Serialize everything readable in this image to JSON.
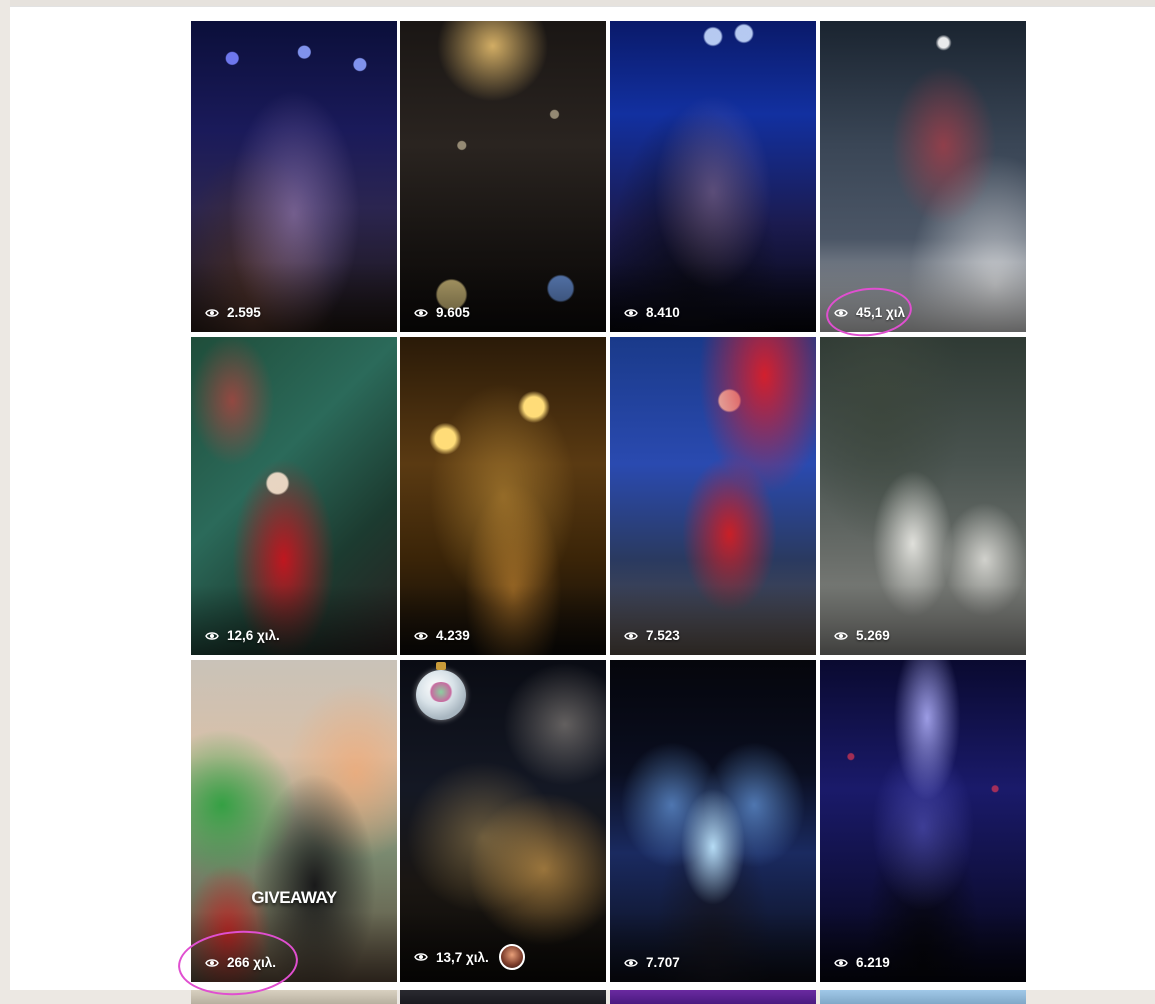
{
  "grid": {
    "tiles": [
      {
        "views": "2.595"
      },
      {
        "views": "9.605"
      },
      {
        "views": "8.410"
      },
      {
        "views": "45,1 χιλ"
      },
      {
        "views": "12,6 χιλ."
      },
      {
        "views": "4.239"
      },
      {
        "views": "7.523"
      },
      {
        "views": "5.269"
      },
      {
        "views": "266 χιλ.",
        "overlay_text": "GIVEAWAY"
      },
      {
        "views": "13,7 χιλ."
      },
      {
        "views": "7.707"
      },
      {
        "views": "6.219"
      }
    ]
  },
  "icons": {
    "views": "eye-icon"
  },
  "colors": {
    "highlight_ring": "#e04fd0",
    "selection": "#3a7bd5"
  }
}
